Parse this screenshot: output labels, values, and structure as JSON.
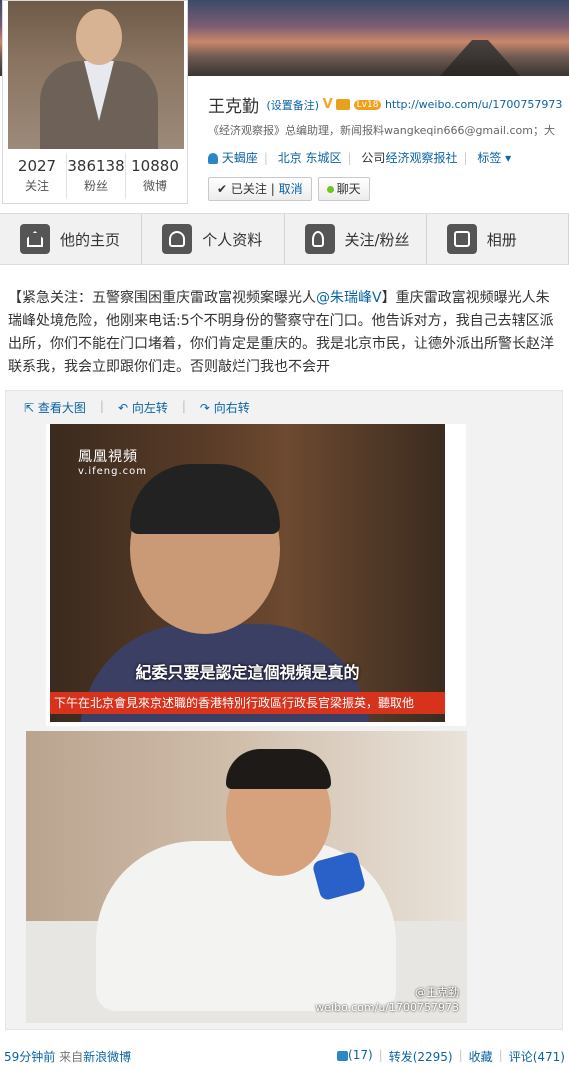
{
  "profile": {
    "name": "王克勤",
    "remark": "(设置备注)",
    "verified": "V",
    "level": "Lv18",
    "url": "http://weibo.com/u/1700757973",
    "bio": "《经济观察报》总编助理，新闻报料wangkeqin666@gmail.com；大",
    "constellation": "天蝎座",
    "location": "北京 东城区",
    "company_label": "公司",
    "company": "经济观察报社",
    "tags": "标签",
    "following_label": "已关注",
    "cancel_label": "取消",
    "chat_label": "聊天",
    "stats": [
      {
        "num": "2027",
        "label": "关注"
      },
      {
        "num": "386138",
        "label": "粉丝"
      },
      {
        "num": "10880",
        "label": "微博"
      }
    ]
  },
  "tabs": [
    {
      "label": "他的主页",
      "icon": "home-icon"
    },
    {
      "label": "个人资料",
      "icon": "profile-icon"
    },
    {
      "label": "关注/粉丝",
      "icon": "fans-icon"
    },
    {
      "label": "相册",
      "icon": "camera-icon"
    }
  ],
  "post": {
    "prefix": "【紧急关注：五警察围困重庆雷政富视频案曝光人",
    "mention": "@朱瑞峰V",
    "body": "】重庆雷政富视频曝光人朱瑞峰处境危险，他刚来电话:5个不明身份的警察守在门口。他告诉对方，我自己去辖区派出所，你们不能在门口堵着，你们肯定是重庆的。我是北京市民，让德外派出所警长赵洋联系我，我会立即跟你们走。否则敲烂门我也不会开"
  },
  "image_tools": {
    "view_large": "查看大图",
    "rotate_left": "向左转",
    "rotate_right": "向右转"
  },
  "pic1": {
    "logo": "鳳凰視頻",
    "logo_url": "v.ifeng.com",
    "subtitle": "紀委只要是認定這個視頻是真的",
    "ticker": "下午在北京會見來京述職的香港特別行政區行政長官梁振英，聽取他"
  },
  "pic2": {
    "watermark_user": "@王克勤",
    "watermark_url": "weibo.com/u/1700757973"
  },
  "footer": {
    "time": "59分钟前",
    "from_label": "来自",
    "source": "新浪微博",
    "like": "(17)",
    "repost": "转发(2295)",
    "favorite": "收藏",
    "comment": "评论(471)"
  },
  "colors": {
    "link": "#0a64a4",
    "badge": "#f5a623",
    "ticker": "#d7321c"
  }
}
